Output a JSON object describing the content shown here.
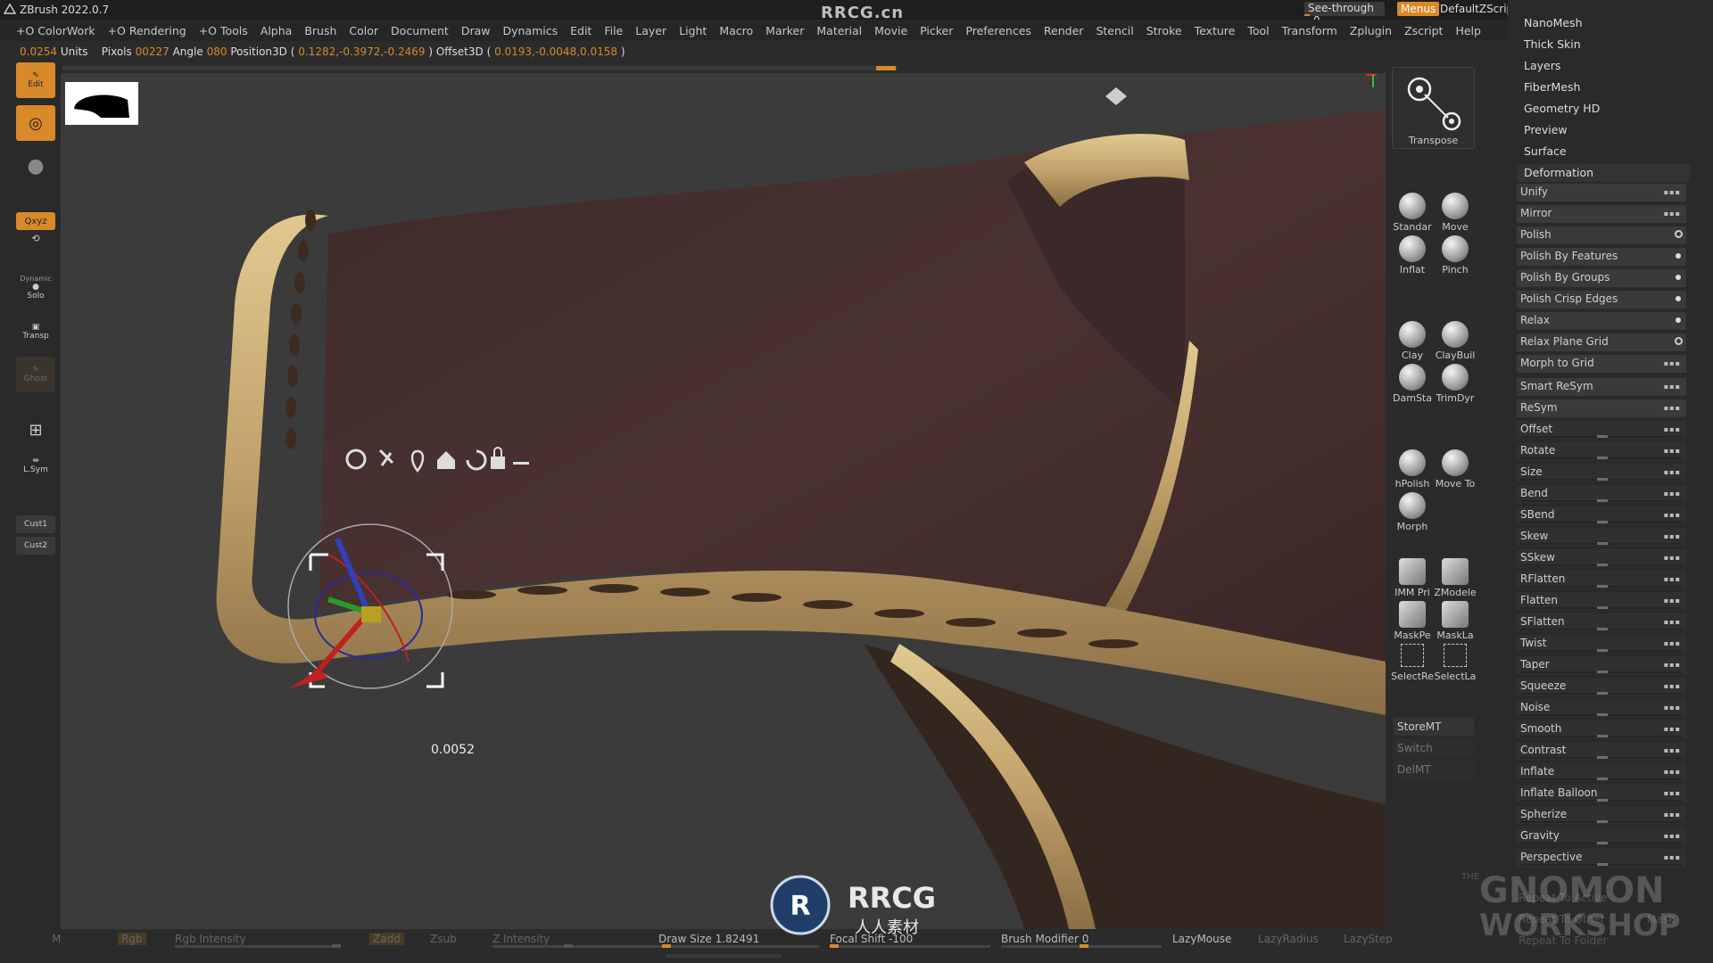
{
  "app": {
    "title": "ZBrush 2022.0.7",
    "watermark_top": "RRCG.cn",
    "see_through_label": "See-through",
    "see_through_value": "0",
    "menus_label": "Menus",
    "default_zscript": "DefaultZScript"
  },
  "menubar": [
    "+O ColorWork",
    "+O Rendering",
    "+O Tools",
    "Alpha",
    "Brush",
    "Color",
    "Document",
    "Draw",
    "Dynamics",
    "Edit",
    "File",
    "Layer",
    "Light",
    "Macro",
    "Marker",
    "Material",
    "Movie",
    "Picker",
    "Preferences",
    "Render",
    "Stencil",
    "Stroke",
    "Texture",
    "Tool",
    "Transform",
    "Zplugin",
    "Zscript",
    "Help"
  ],
  "infobar": {
    "units_value": "0.0254",
    "units_label": "Units",
    "pixols_label": "Pixols",
    "pixols_value": "00227",
    "angle_label": "Angle",
    "angle_value": "080",
    "position_label": "Position3D (",
    "position_value": "0.1282,-0.3972,-0.2469",
    "offset_label": ") Offset3D (",
    "offset_value": "0.0193,-0.0048,0.0158",
    "close_paren": ")"
  },
  "left_tray": {
    "edit": "Edit",
    "xyz": "Qxyz",
    "dynamic": "Dynamic",
    "solo": "Solo",
    "transp": "Transp",
    "ghost": "Ghost",
    "lsym": "L.Sym",
    "cust1": "Cust1",
    "cust2": "Cust2"
  },
  "transpose_panel": {
    "label": "Transpose"
  },
  "brushes": [
    {
      "label": "Standar"
    },
    {
      "label": "Move"
    },
    {
      "label": "Inflat"
    },
    {
      "label": "Pinch"
    },
    {
      "label": "Clay"
    },
    {
      "label": "ClayBuil"
    },
    {
      "label": "DamSta"
    },
    {
      "label": "TrimDyr"
    },
    {
      "label": "hPolish"
    },
    {
      "label": "Move To"
    },
    {
      "label": "Morph"
    },
    {
      "label": "IMM Pri"
    },
    {
      "label": "ZModele"
    },
    {
      "label": "MaskPe"
    },
    {
      "label": "MaskLa"
    },
    {
      "label": "SelectRe"
    },
    {
      "label": "SelectLa"
    }
  ],
  "mt_buttons": {
    "store": "StoreMT",
    "switch": "Switch",
    "del": "DelMT"
  },
  "subpalettes": [
    "NanoMesh",
    "Thick Skin",
    "Layers",
    "FiberMesh",
    "Geometry HD",
    "Preview",
    "Surface"
  ],
  "deformation": {
    "header": "Deformation",
    "rows": [
      "Unify",
      "Mirror",
      "Polish",
      "Polish By Features",
      "Polish By Groups",
      "Polish Crisp Edges",
      "Relax",
      "Relax Plane Grid",
      "Morph to Grid",
      "Smart ReSym",
      "ReSym",
      "Offset",
      "Rotate",
      "Size",
      "Bend",
      "SBend",
      "Skew",
      "SSkew",
      "RFlatten",
      "Flatten",
      "SFlatten",
      "Twist",
      "Taper",
      "Squeeze",
      "Noise",
      "Smooth",
      "Contrast",
      "Inflate",
      "Inflate Balloon",
      "Spherize",
      "Gravity",
      "Perspective"
    ],
    "faint": [
      "Repeat To Active",
      "Repeat To Other",
      "Repeat To Folder"
    ],
    "mask_label": "Mask"
  },
  "gizmo_value": "0.0052",
  "bottom": {
    "m": "M",
    "rgb": "Rgb",
    "rgb_intensity": "Rgb Intensity",
    "zadd": "Zadd",
    "zsub": "Zsub",
    "z_intensity": "Z Intensity",
    "draw_size": "Draw Size 1.82491",
    "focal_shift": "Focal Shift -100",
    "brush_modifier": "Brush Modifier 0",
    "lazymouse": "LazyMouse",
    "lazyradius": "LazyRadius",
    "lazystep": "LazyStep"
  },
  "watermarks": {
    "rrcg": "RRCG",
    "rrcg_cn": "人人素材",
    "gnomon_line1": "THE",
    "gnomon_line2": "GNOMON",
    "gnomon_line3": "WORKSHOP"
  },
  "colors": {
    "accent": "#d8892a",
    "leather": "#4a3030",
    "trim": "#c9ab72"
  }
}
